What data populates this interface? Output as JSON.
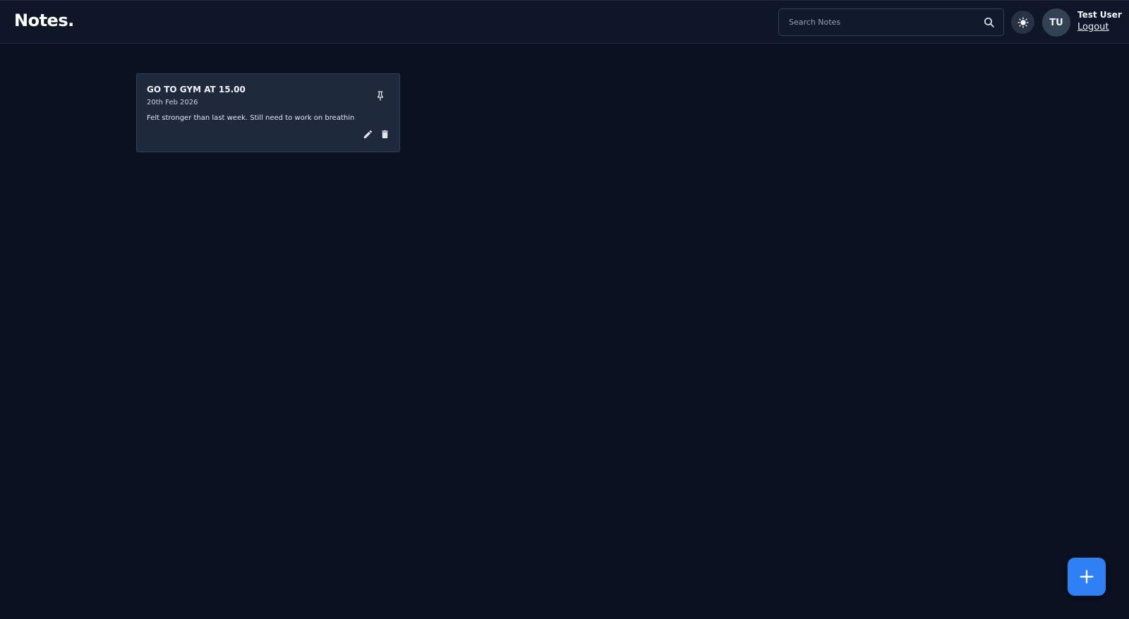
{
  "navbar": {
    "logo": "Notes.",
    "search": {
      "placeholder": "Search Notes",
      "value": "",
      "icon": "search-icon"
    },
    "theme_toggle_icon": "sun-icon",
    "user": {
      "initials": "TU",
      "name": "Test User",
      "logout_label": "Logout"
    }
  },
  "notes": [
    {
      "title": "GO TO GYM AT 15.00",
      "date": "20th Feb 2026",
      "content": "Felt stronger than last week. Still need to work on breathin",
      "pinned": false,
      "icons": [
        "pin-icon",
        "edit-icon",
        "delete-icon"
      ]
    }
  ],
  "add_button_icon": "plus-icon",
  "colors": {
    "background": "#0b1120",
    "navbar": "#0e1627",
    "card": "#1e293b",
    "accent": "#2f7ff5"
  }
}
